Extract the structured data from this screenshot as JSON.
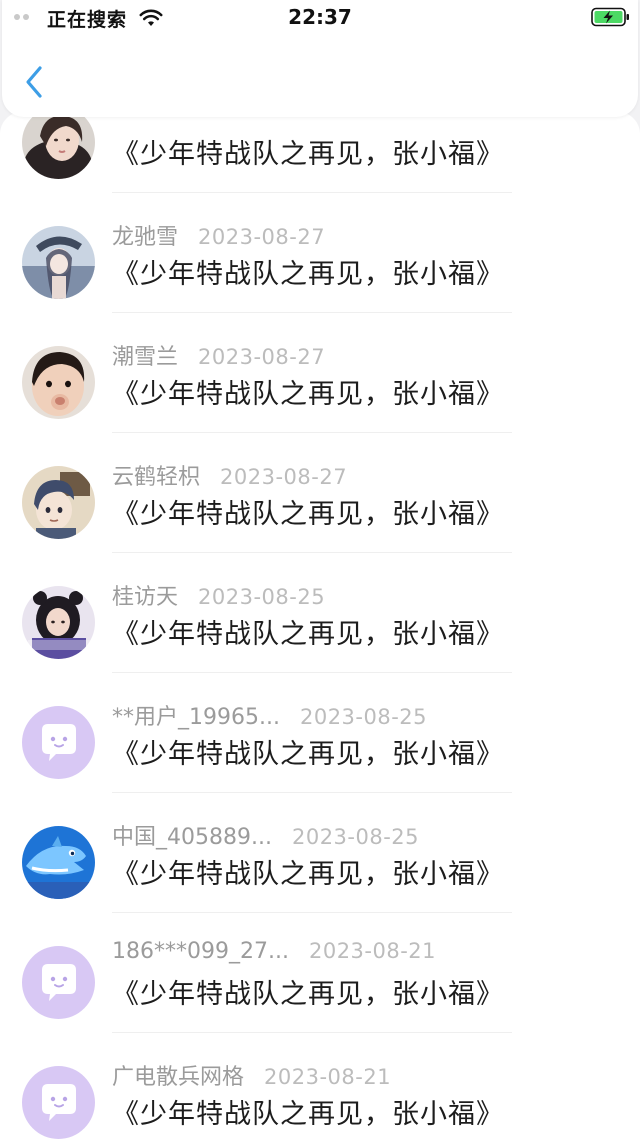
{
  "status_bar": {
    "carrier": "正在搜索",
    "time": "22:37"
  },
  "header": {
    "back_icon": "chevron-left-icon",
    "accent_color": "#3d9ee6"
  },
  "items": [
    {
      "name": "",
      "date": "",
      "title": "《少年特战队之再见，张小福》",
      "avatar": "photo-woman"
    },
    {
      "name": "龙驰雪",
      "date": "2023-08-27",
      "title": "《少年特战队之再见，张小福》",
      "avatar": "anime-girl"
    },
    {
      "name": "潮雪兰",
      "date": "2023-08-27",
      "title": "《少年特战队之再见，张小福》",
      "avatar": "photo-child"
    },
    {
      "name": "云鹤轻枳",
      "date": "2023-08-27",
      "title": "《少年特战队之再见，张小福》",
      "avatar": "cartoon-boy"
    },
    {
      "name": "桂访天",
      "date": "2023-08-25",
      "title": "《少年特战队之再见，张小福》",
      "avatar": "photo-girl-hood"
    },
    {
      "name": "**用户_19965...",
      "date": "2023-08-25",
      "title": "《少年特战队之再见，张小福》",
      "avatar": "default-chat"
    },
    {
      "name": "中国_405889...",
      "date": "2023-08-25",
      "title": "《少年特战队之再见，张小福》",
      "avatar": "dolphin"
    },
    {
      "name": "186***099_27...",
      "date": "2023-08-21",
      "title": "《少年特战队之再见，张小福》",
      "avatar": "default-chat"
    },
    {
      "name": "广电散兵网格",
      "date": "2023-08-21",
      "title": "《少年特战队之再见，张小福》",
      "avatar": "default-chat"
    }
  ]
}
